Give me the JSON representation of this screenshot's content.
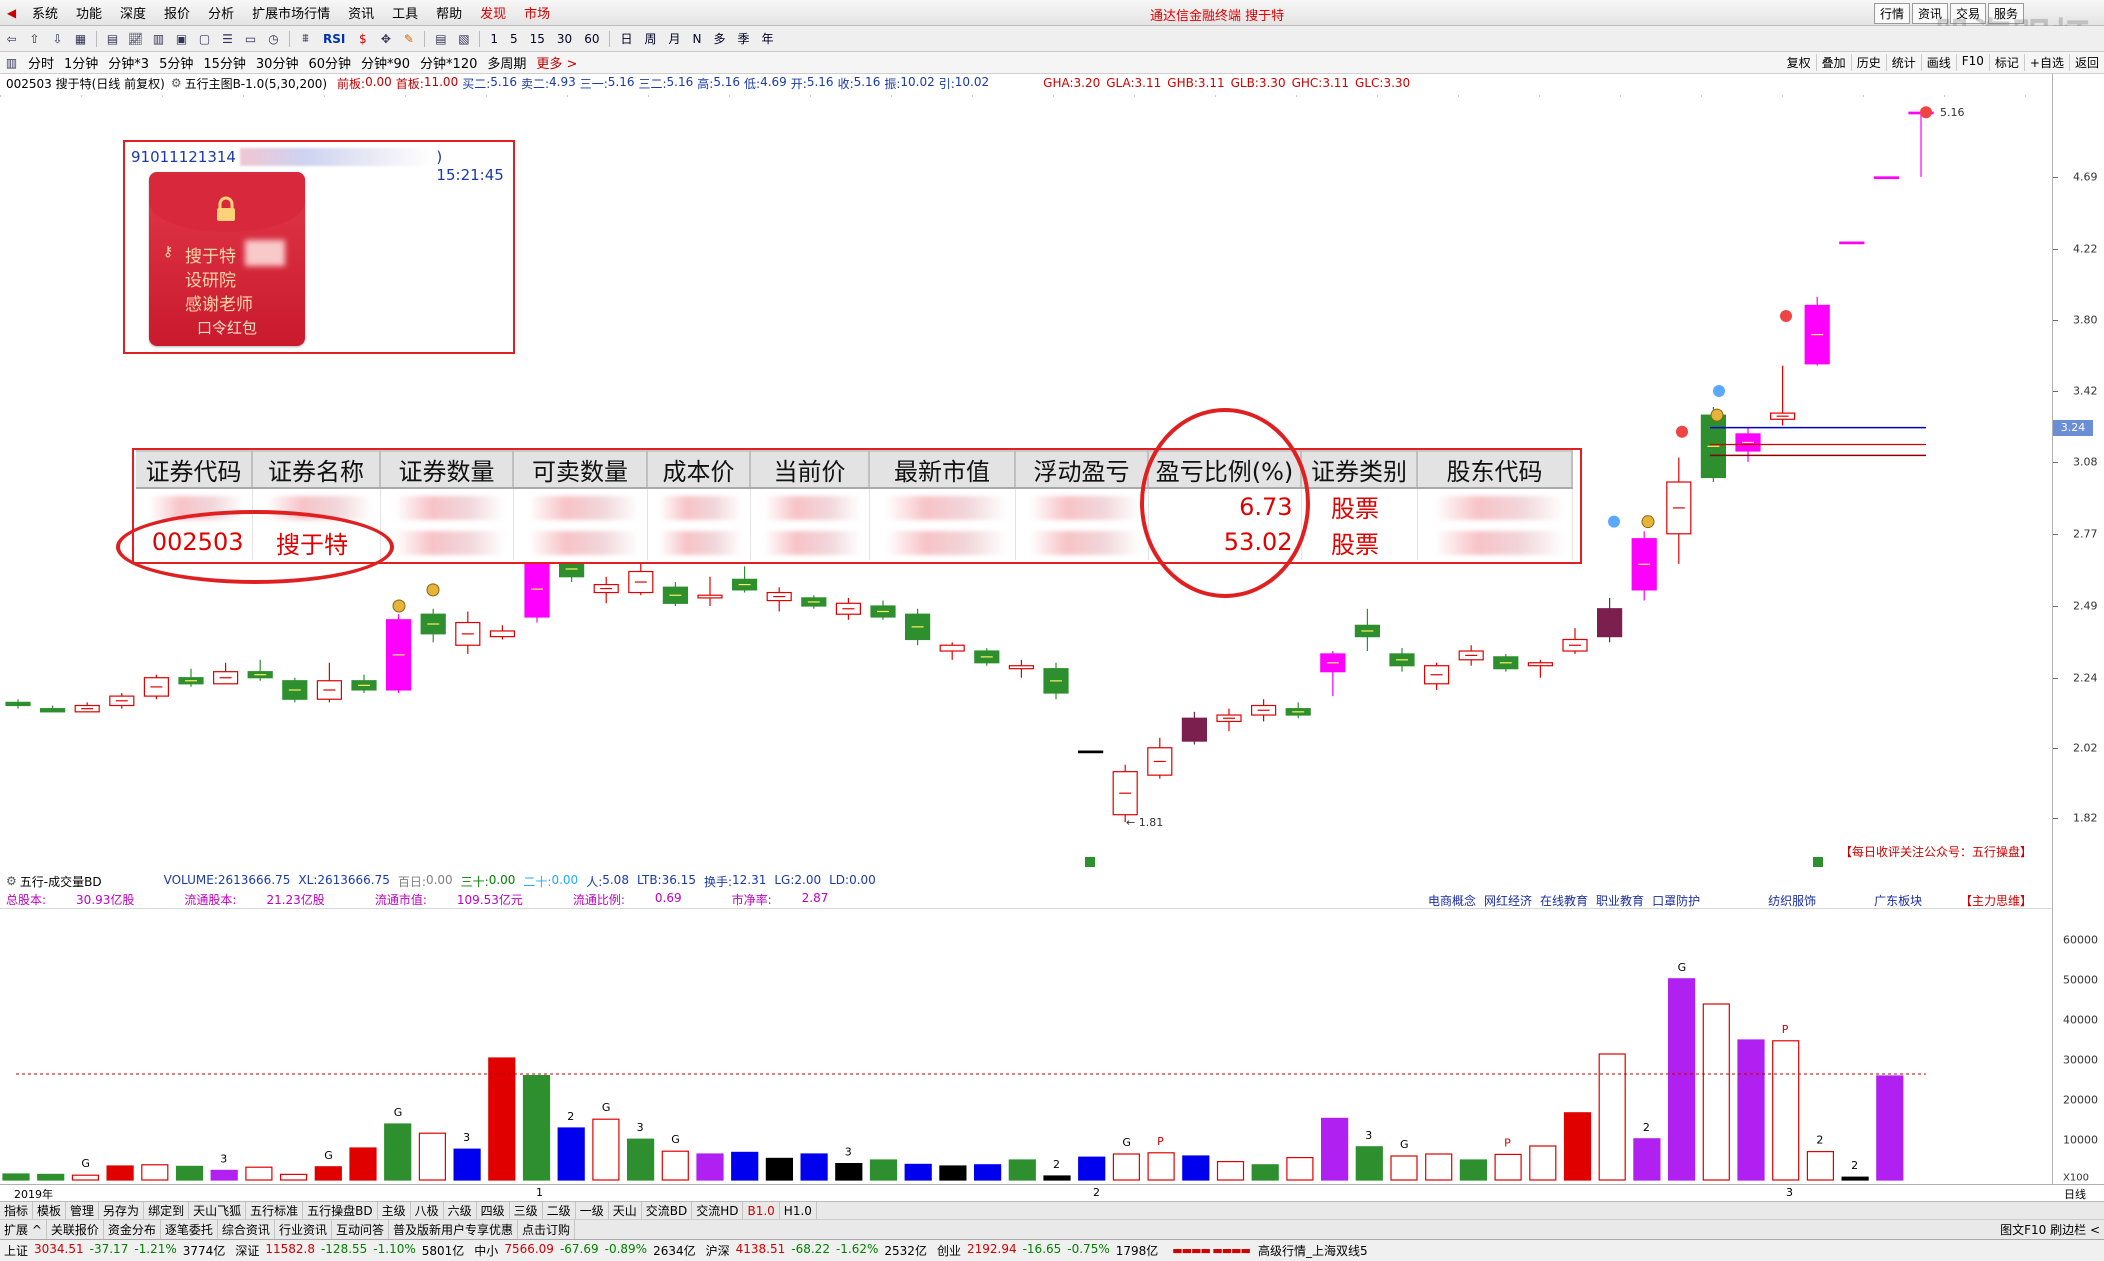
{
  "menubar": {
    "items": [
      "系统",
      "功能",
      "深度",
      "报价",
      "分析",
      "扩展市场行情",
      "资讯",
      "工具",
      "帮助"
    ],
    "hot_items": [
      "发现",
      "市场"
    ],
    "title": "通达信金融终端  搜于特",
    "right_buttons": [
      "行情",
      "资讯",
      "交易",
      "服务"
    ],
    "watermark": "股海明灯"
  },
  "toolbar": {
    "text_items": [
      "RSI",
      "1",
      "5",
      "15",
      "30",
      "60",
      "日",
      "周",
      "月",
      "N",
      "多",
      "季",
      "年"
    ]
  },
  "periodbar": {
    "items": [
      "分时",
      "1分钟",
      "分钟*3",
      "5分钟",
      "15分钟",
      "30分钟",
      "60分钟",
      "分钟*90",
      "分钟*120",
      "多周期"
    ],
    "more": "更多 >",
    "right_buttons": [
      "复权",
      "叠加",
      "历史",
      "统计",
      "画线",
      "F10",
      "标记",
      "+自选",
      "返回"
    ]
  },
  "infobar": {
    "stock": "002503 搜于特(日线 前复权)",
    "indicator": "五行主图B-1.0(5,30,200)",
    "fields": [
      {
        "label": "前板:",
        "value": "0.00",
        "color": "#c00000"
      },
      {
        "label": "首板:",
        "value": "11.00",
        "color": "#c00000"
      },
      {
        "label": "买二:",
        "value": "5.16",
        "color": "#1a3aa8"
      },
      {
        "label": "卖二:",
        "value": "4.93",
        "color": "#1a3aa8"
      },
      {
        "label": "三一:",
        "value": "5.16",
        "color": "#1a3aa8"
      },
      {
        "label": "三二:",
        "value": "5.16",
        "color": "#1a3aa8"
      },
      {
        "label": "高:",
        "value": "5.16",
        "color": "#1a3aa8"
      },
      {
        "label": "低:",
        "value": "4.69",
        "color": "#1a3aa8"
      },
      {
        "label": "开:",
        "value": "5.16",
        "color": "#1a3aa8"
      },
      {
        "label": "收:",
        "value": "5.16",
        "color": "#1a3aa8"
      },
      {
        "label": "振:",
        "value": "10.02",
        "color": "#1a3aa8"
      },
      {
        "label": "引:",
        "value": "10.02",
        "color": "#1a3aa8"
      }
    ],
    "g_fields": [
      {
        "label": "GHA:",
        "value": "3.20"
      },
      {
        "label": "GLA:",
        "value": "3.11"
      },
      {
        "label": "GHB:",
        "value": "3.11"
      },
      {
        "label": "GLB:",
        "value": "3.30"
      },
      {
        "label": "GHC:",
        "value": "3.11"
      },
      {
        "label": "GLC:",
        "value": "3.30"
      }
    ]
  },
  "price_axis": {
    "ticks": [
      "4.69",
      "4.22",
      "3.80",
      "3.42",
      "3.08",
      "2.77",
      "2.49",
      "2.24",
      "2.02",
      "1.82"
    ],
    "current": "3.24"
  },
  "annotations": {
    "high_label": "5.16",
    "low_label": "← 1.81",
    "notice": "【每日收评关注公众号：五行操盘】"
  },
  "packet": {
    "header_prefix": "91011121314",
    "header_suffix": ") 15:21:45",
    "lines": [
      "搜于特",
      "设研院",
      "感谢老师"
    ],
    "footer": "口令红包"
  },
  "holdings": {
    "headers": [
      "证券代码",
      "证券名称",
      "证券数量",
      "可卖数量",
      "成本价",
      "当前价",
      "最新市值",
      "浮动盈亏",
      "盈亏比例(%)",
      "证券类别",
      "股东代码"
    ],
    "rows": [
      {
        "code": "",
        "name": "",
        "pct": "6.73",
        "type": "股票"
      },
      {
        "code": "002503",
        "name": "搜于特",
        "pct": "53.02",
        "type": "股票"
      }
    ]
  },
  "volume": {
    "title": "五行-成交量BD",
    "fields": [
      {
        "label": "VOLUME:",
        "value": "2613666.75",
        "color": "#1a3aa8"
      },
      {
        "label": "XL:",
        "value": "2613666.75",
        "color": "#1a3aa8"
      },
      {
        "label": "百日:",
        "value": "0.00",
        "color": "#808080"
      },
      {
        "label": "三十:",
        "value": "0.00",
        "color": "#008000"
      },
      {
        "label": "二十:",
        "value": "0.00",
        "color": "#22aaff"
      },
      {
        "label": "人:",
        "value": "5.08",
        "color": "#1a3aa8"
      },
      {
        "label": "LTB:",
        "value": "36.15",
        "color": "#1a3aa8"
      },
      {
        "label": "换手:",
        "value": "12.31",
        "color": "#1a3aa8"
      },
      {
        "label": "LG:",
        "value": "2.00",
        "color": "#1a3aa8"
      },
      {
        "label": "LD:",
        "value": "0.00",
        "color": "#1a3aa8"
      }
    ],
    "stats": [
      {
        "label": "总股本:",
        "value": "30.93亿股"
      },
      {
        "label": "流通股本:",
        "value": "21.23亿股"
      },
      {
        "label": "流通市值:",
        "value": "109.53亿元"
      },
      {
        "label": "流通比例:",
        "value": "0.69"
      },
      {
        "label": "市净率:",
        "value": "2.87"
      }
    ],
    "concepts": [
      "电商概念",
      "网红经济",
      "在线教育",
      "职业教育",
      "口罩防护",
      "纺织服饰",
      "广东板块"
    ],
    "main_force": "【主力思维】",
    "ticks": [
      "60000",
      "50000",
      "40000",
      "30000",
      "20000",
      "10000"
    ],
    "unit": "X100"
  },
  "dateaxis": {
    "labels": [
      "2019年",
      "1",
      "2",
      "3"
    ],
    "right": "日线"
  },
  "tabs1": {
    "items": [
      "指标",
      "模板",
      "管理",
      "另存为",
      "绑定到",
      "天山飞狐",
      "五行标准",
      "五行操盘BD",
      "主级",
      "八极",
      "六级",
      "四级",
      "三级",
      "二级",
      "一级",
      "天山",
      "交流BD",
      "交流HD",
      "B1.0",
      "H1.0"
    ],
    "red": [
      "B1.0"
    ]
  },
  "tabs2": {
    "items": [
      "扩展 ^",
      "关联报价",
      "资金分布",
      "逐笔委托",
      "综合资讯",
      "行业资讯",
      "互动问答",
      "普及版新用户专享优惠",
      "点击订购"
    ],
    "right": "图文F10 刷边栏 <"
  },
  "statusbar": {
    "indices": [
      {
        "name": "上证",
        "value": "3034.51",
        "chg": "-37.17",
        "pct": "-1.21%",
        "amt": "3774亿"
      },
      {
        "name": "深证",
        "value": "11582.8",
        "chg": "-128.55",
        "pct": "-1.10%",
        "amt": "5801亿"
      },
      {
        "name": "中小",
        "value": "7566.09",
        "chg": "-67.69",
        "pct": "-0.89%",
        "amt": "2634亿"
      },
      {
        "name": "沪深",
        "value": "4138.51",
        "chg": "-68.22",
        "pct": "-1.62%",
        "amt": "2532亿"
      },
      {
        "name": "创业",
        "value": "2192.94",
        "chg": "-16.65",
        "pct": "-0.75%",
        "amt": "1798亿"
      }
    ],
    "feed": "高级行情_上海双线5"
  },
  "colors": {
    "up": "#e00000",
    "down": "#2d8f2d",
    "magenta": "#ff00ff",
    "purple": "#b020f0",
    "blue": "#0000ee",
    "black": "#000000",
    "maroon": "#7a1f4e"
  },
  "chart_data": [
    {
      "type": "candlestick",
      "ylim": [
        1.75,
        5.2
      ],
      "candles": [
        {
          "o": 2.16,
          "h": 2.17,
          "l": 2.14,
          "c": 2.15,
          "s": "down"
        },
        {
          "o": 2.14,
          "h": 2.15,
          "l": 2.13,
          "c": 2.13,
          "s": "down"
        },
        {
          "o": 2.13,
          "h": 2.16,
          "l": 2.13,
          "c": 2.15,
          "s": "up"
        },
        {
          "o": 2.15,
          "h": 2.19,
          "l": 2.14,
          "c": 2.18,
          "s": "up"
        },
        {
          "o": 2.18,
          "h": 2.25,
          "l": 2.17,
          "c": 2.24,
          "s": "up"
        },
        {
          "o": 2.24,
          "h": 2.27,
          "l": 2.21,
          "c": 2.22,
          "s": "down"
        },
        {
          "o": 2.22,
          "h": 2.29,
          "l": 2.22,
          "c": 2.26,
          "s": "up"
        },
        {
          "o": 2.26,
          "h": 2.3,
          "l": 2.23,
          "c": 2.24,
          "s": "down"
        },
        {
          "o": 2.23,
          "h": 2.24,
          "l": 2.16,
          "c": 2.17,
          "s": "down"
        },
        {
          "o": 2.17,
          "h": 2.29,
          "l": 2.16,
          "c": 2.23,
          "s": "up"
        },
        {
          "o": 2.23,
          "h": 2.25,
          "l": 2.19,
          "c": 2.2,
          "s": "down"
        },
        {
          "o": 2.2,
          "h": 2.46,
          "l": 2.19,
          "c": 2.44,
          "s": "mag"
        },
        {
          "o": 2.46,
          "h": 2.48,
          "l": 2.36,
          "c": 2.39,
          "s": "down"
        },
        {
          "o": 2.35,
          "h": 2.47,
          "l": 2.32,
          "c": 2.43,
          "s": "up"
        },
        {
          "o": 2.38,
          "h": 2.42,
          "l": 2.37,
          "c": 2.4,
          "s": "up"
        },
        {
          "o": 2.45,
          "h": 2.68,
          "l": 2.43,
          "c": 2.66,
          "s": "mag"
        },
        {
          "o": 2.66,
          "h": 2.74,
          "l": 2.58,
          "c": 2.6,
          "s": "down"
        },
        {
          "o": 2.54,
          "h": 2.6,
          "l": 2.5,
          "c": 2.57,
          "s": "up"
        },
        {
          "o": 2.54,
          "h": 2.68,
          "l": 2.53,
          "c": 2.62,
          "s": "up"
        },
        {
          "o": 2.56,
          "h": 2.58,
          "l": 2.49,
          "c": 2.5,
          "s": "down"
        },
        {
          "o": 2.52,
          "h": 2.6,
          "l": 2.49,
          "c": 2.53,
          "s": "up"
        },
        {
          "o": 2.59,
          "h": 2.64,
          "l": 2.54,
          "c": 2.55,
          "s": "down"
        },
        {
          "o": 2.51,
          "h": 2.56,
          "l": 2.47,
          "c": 2.54,
          "s": "up"
        },
        {
          "o": 2.52,
          "h": 2.53,
          "l": 2.48,
          "c": 2.49,
          "s": "down"
        },
        {
          "o": 2.46,
          "h": 2.52,
          "l": 2.44,
          "c": 2.5,
          "s": "up"
        },
        {
          "o": 2.49,
          "h": 2.51,
          "l": 2.44,
          "c": 2.45,
          "s": "down"
        },
        {
          "o": 2.46,
          "h": 2.48,
          "l": 2.35,
          "c": 2.37,
          "s": "down"
        },
        {
          "o": 2.33,
          "h": 2.36,
          "l": 2.3,
          "c": 2.35,
          "s": "up"
        },
        {
          "o": 2.33,
          "h": 2.34,
          "l": 2.28,
          "c": 2.29,
          "s": "down"
        },
        {
          "o": 2.27,
          "h": 2.3,
          "l": 2.24,
          "c": 2.28,
          "s": "up"
        },
        {
          "o": 2.27,
          "h": 2.29,
          "l": 2.17,
          "c": 2.19,
          "s": "down"
        },
        {
          "o": 2.01,
          "h": 2.01,
          "l": 2.01,
          "c": 2.01,
          "s": "flat"
        },
        {
          "o": 1.83,
          "h": 1.97,
          "l": 1.81,
          "c": 1.95,
          "s": "up"
        },
        {
          "o": 1.94,
          "h": 2.05,
          "l": 1.93,
          "c": 2.02,
          "s": "up"
        },
        {
          "o": 2.04,
          "h": 2.13,
          "l": 2.03,
          "c": 2.11,
          "s": "maroon"
        },
        {
          "o": 2.1,
          "h": 2.14,
          "l": 2.07,
          "c": 2.12,
          "s": "up"
        },
        {
          "o": 2.12,
          "h": 2.17,
          "l": 2.1,
          "c": 2.15,
          "s": "up"
        },
        {
          "o": 2.14,
          "h": 2.16,
          "l": 2.11,
          "c": 2.12,
          "s": "down"
        },
        {
          "o": 2.26,
          "h": 2.33,
          "l": 2.18,
          "c": 2.32,
          "s": "mag"
        },
        {
          "o": 2.42,
          "h": 2.48,
          "l": 2.33,
          "c": 2.38,
          "s": "down"
        },
        {
          "o": 2.32,
          "h": 2.34,
          "l": 2.26,
          "c": 2.28,
          "s": "down"
        },
        {
          "o": 2.22,
          "h": 2.29,
          "l": 2.2,
          "c": 2.28,
          "s": "up"
        },
        {
          "o": 2.3,
          "h": 2.35,
          "l": 2.28,
          "c": 2.33,
          "s": "up"
        },
        {
          "o": 2.31,
          "h": 2.32,
          "l": 2.26,
          "c": 2.27,
          "s": "down"
        },
        {
          "o": 2.28,
          "h": 2.3,
          "l": 2.24,
          "c": 2.29,
          "s": "up"
        },
        {
          "o": 2.33,
          "h": 2.41,
          "l": 2.32,
          "c": 2.37,
          "s": "up"
        },
        {
          "o": 2.38,
          "h": 2.52,
          "l": 2.36,
          "c": 2.48,
          "s": "maroon"
        },
        {
          "o": 2.55,
          "h": 2.78,
          "l": 2.51,
          "c": 2.75,
          "s": "mag"
        },
        {
          "o": 2.77,
          "h": 3.1,
          "l": 2.65,
          "c": 2.99,
          "s": "up"
        },
        {
          "o": 3.3,
          "h": 3.34,
          "l": 2.99,
          "c": 3.01,
          "s": "down"
        },
        {
          "o": 3.13,
          "h": 3.24,
          "l": 3.08,
          "c": 3.21,
          "s": "mag"
        },
        {
          "o": 3.28,
          "h": 3.55,
          "l": 3.25,
          "c": 3.31,
          "s": "up"
        },
        {
          "o": 3.56,
          "h": 3.93,
          "l": 3.55,
          "c": 3.88,
          "s": "mag"
        },
        {
          "o": 4.26,
          "h": 4.26,
          "l": 4.26,
          "c": 4.26,
          "s": "flatred"
        },
        {
          "o": 4.69,
          "h": 4.69,
          "l": 4.69,
          "c": 4.69,
          "s": "flatred"
        },
        {
          "o": 5.16,
          "h": 5.16,
          "l": 4.69,
          "c": 5.16,
          "s": "flatred"
        }
      ]
    },
    {
      "type": "bar",
      "ylim": [
        0,
        60000
      ],
      "values": [
        1500,
        1400,
        1200,
        3500,
        3800,
        3400,
        2400,
        3200,
        1400,
        3300,
        8000,
        14000,
        11700,
        7700,
        30500,
        26100,
        13000,
        15200,
        10200,
        7200,
        6500,
        6900,
        5400,
        6500,
        4100,
        5000,
        3900,
        3500,
        3800,
        5000,
        1000,
        5700,
        6500,
        6800,
        6000,
        4600,
        3800,
        5600,
        15400,
        8300,
        6000,
        6500,
        5000,
        6400,
        8500,
        16800,
        31500,
        10300,
        50300,
        44000,
        35000,
        34800,
        7100,
        700,
        26000
      ],
      "styles": [
        "down",
        "down",
        "hollow",
        "up",
        "hollow",
        "down",
        "purple",
        "hollow",
        "hollow",
        "up",
        "up",
        "down",
        "hollow",
        "blue",
        "up",
        "down",
        "blue",
        "hollow",
        "down",
        "hollow",
        "purple",
        "blue",
        "black",
        "blue",
        "black",
        "down",
        "blue",
        "black",
        "blue",
        "down",
        "black",
        "blue",
        "hollow",
        "hollow",
        "blue",
        "hollow",
        "down",
        "hollow",
        "purple",
        "down",
        "hollow",
        "hollow",
        "down",
        "hollow",
        "hollow",
        "up",
        "hollow",
        "purple",
        "purple",
        "hollow",
        "purple",
        "hollow",
        "hollow",
        "black",
        "purple"
      ],
      "labels": [
        {
          "i": 2,
          "t": "G"
        },
        {
          "i": 6,
          "t": "3"
        },
        {
          "i": 9,
          "t": "G"
        },
        {
          "i": 11,
          "t": "G"
        },
        {
          "i": 13,
          "t": "3"
        },
        {
          "i": 16,
          "t": "2"
        },
        {
          "i": 17,
          "t": "G"
        },
        {
          "i": 18,
          "t": "3"
        },
        {
          "i": 19,
          "t": "G"
        },
        {
          "i": 24,
          "t": "3"
        },
        {
          "i": 30,
          "t": "2"
        },
        {
          "i": 32,
          "t": "G"
        },
        {
          "i": 33,
          "t": "P"
        },
        {
          "i": 39,
          "t": "3"
        },
        {
          "i": 40,
          "t": "G"
        },
        {
          "i": 43,
          "t": "P"
        },
        {
          "i": 47,
          "t": "2"
        },
        {
          "i": 48,
          "t": "G"
        },
        {
          "i": 51,
          "t": "P"
        },
        {
          "i": 52,
          "t": "2"
        },
        {
          "i": 53,
          "t": "2"
        }
      ],
      "avg_line": 26500
    }
  ]
}
